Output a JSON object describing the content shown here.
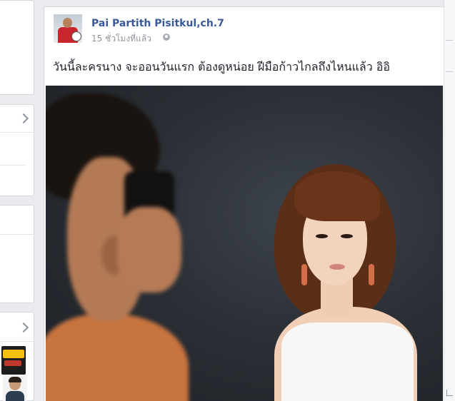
{
  "post": {
    "author_name": "Pai Partith Pisitkul,ch.7",
    "timestamp": "15 ชั่วโมงที่แล้ว",
    "privacy_icon": "globe-icon",
    "text": "วันนี้ละครนาง จะออนวันแรก ต้องดูหน่อย ฝีมือก้าวไกลถึงไหนแล้ว อิอิ"
  },
  "left_column": {
    "chevron_icon": "chevron-right-icon",
    "thumbnail_1": "tv-channel-logo",
    "thumbnail_2": "person-avatar"
  },
  "colors": {
    "page_bg": "#e9ebee",
    "card_bg": "#ffffff",
    "link_blue": "#3b5998",
    "meta_gray": "#90949c",
    "text": "#1d2129"
  }
}
